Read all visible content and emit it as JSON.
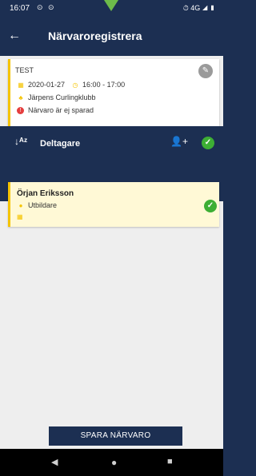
{
  "status_bar": {
    "time": "16:07",
    "left_icons": "⊙ ⊙",
    "right_icons": "⏱ 4G ◢ ▮"
  },
  "app_bar": {
    "title": "Närvaroregistrera",
    "back_icon": "arrow-left-icon"
  },
  "event": {
    "name": "TEST",
    "date": "2020-01-27",
    "time": "16:00 - 17:00",
    "club": "Järpens Curlingklubb",
    "status": "Närvaro är ej sparad"
  },
  "participants_header": {
    "label": "Deltagare"
  },
  "participants": [
    {
      "name": "Örjan Eriksson",
      "role": "Utbildare"
    }
  ],
  "save_button": {
    "label": "SPARA NÄRVARO"
  },
  "colors": {
    "primary": "#1c2f52",
    "accent_yellow": "#f5c400",
    "success_green": "#3dae34",
    "error_red": "#e53e3e"
  }
}
